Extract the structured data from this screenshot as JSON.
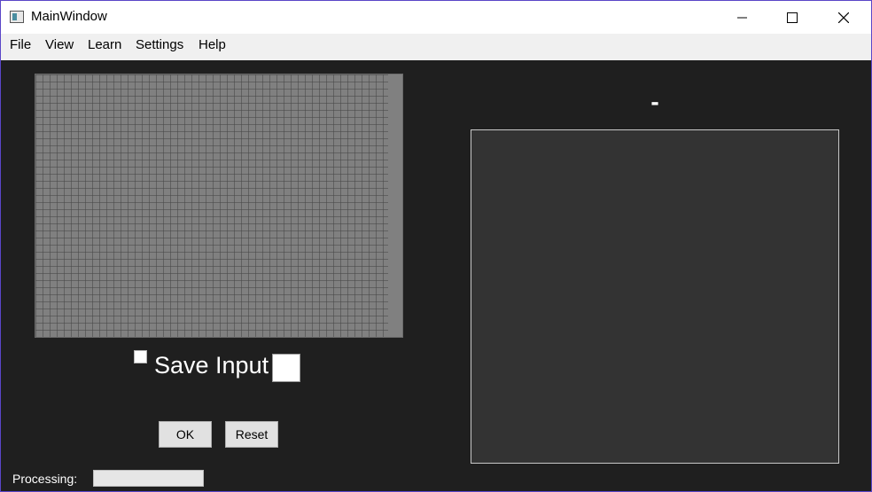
{
  "window": {
    "title": "MainWindow",
    "minimize_icon": "minimize-icon",
    "maximize_icon": "maximize-icon",
    "close_icon": "close-icon"
  },
  "menu": {
    "items": [
      {
        "label": "File"
      },
      {
        "label": "View"
      },
      {
        "label": "Learn"
      },
      {
        "label": "Settings"
      },
      {
        "label": "Help"
      }
    ]
  },
  "input": {
    "save_label": "Save Input",
    "save_checked": false
  },
  "buttons": {
    "ok_label": "OK",
    "reset_label": "Reset"
  },
  "status": {
    "processing_label": "Processing:",
    "progress": 0
  },
  "output": {
    "result_text": "-"
  },
  "colors": {
    "background": "#1f1f1f",
    "grid": "#808080",
    "output_panel": "#333333",
    "window_border": "#5a46c8"
  }
}
